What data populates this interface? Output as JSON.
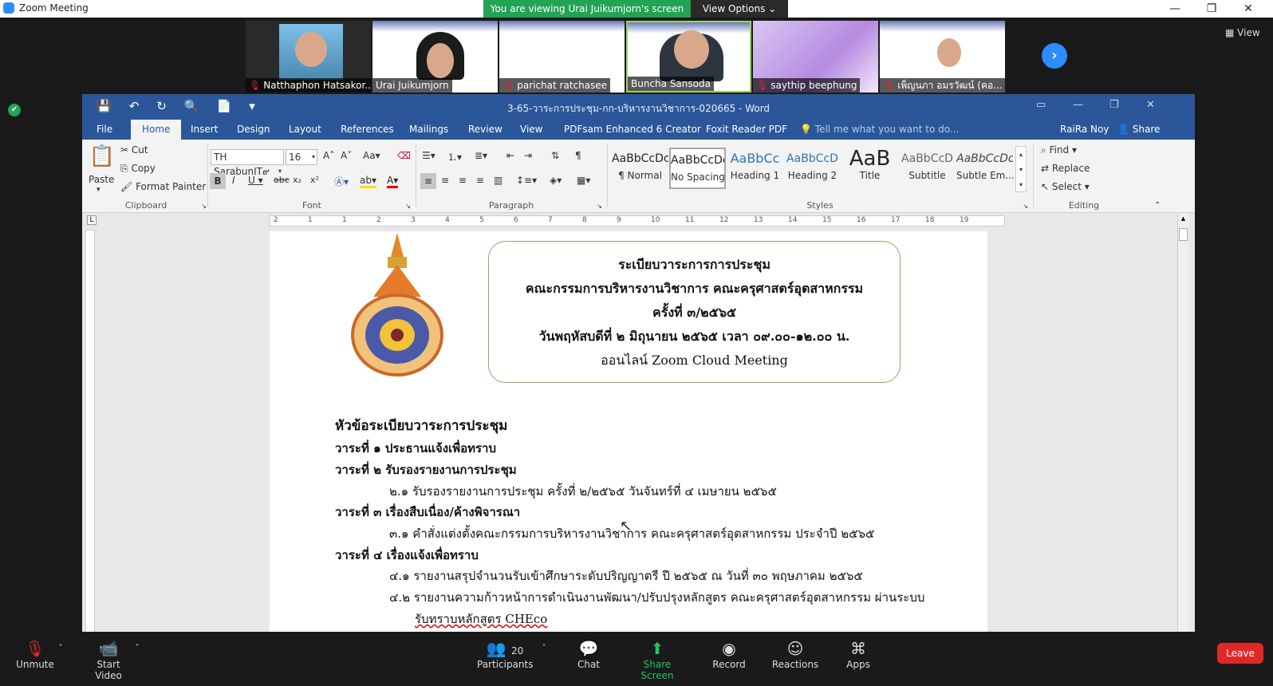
{
  "zoom": {
    "window_title": "Zoom Meeting",
    "share_banner": "You are viewing Urai Juikumjorn's screen",
    "view_options": "View Options",
    "view_button": "View",
    "participants": [
      {
        "name": "Natthaphon Hatsakor..."
      },
      {
        "name": "Urai Juikumjorn"
      },
      {
        "name": "parichat ratchasee"
      },
      {
        "name": "Buncha Sansoda"
      },
      {
        "name": "saythip beephung"
      },
      {
        "name": "เพ็ญนภา อมรวัฒน์ (คอ..."
      }
    ],
    "toolbar": {
      "unmute": "Unmute",
      "start_video": "Start Video",
      "participants": "Participants",
      "participant_count": "20",
      "chat": "Chat",
      "share_screen": "Share Screen",
      "record": "Record",
      "reactions": "Reactions",
      "apps": "Apps",
      "leave": "Leave"
    }
  },
  "word": {
    "doc_title": "3-65-วาระการประชุม-กก-บริหารงานวิชาการ-020665 - Word",
    "tabs": [
      "File",
      "Home",
      "Insert",
      "Design",
      "Layout",
      "References",
      "Mailings",
      "Review",
      "View",
      "PDFsam Enhanced 6 Creator",
      "Foxit Reader PDF"
    ],
    "tell_me": "Tell me what you want to do...",
    "user": "RaiRa Noy",
    "share": "Share",
    "clipboard": {
      "paste": "Paste",
      "cut": "Cut",
      "copy": "Copy",
      "format_painter": "Format Painter",
      "label": "Clipboard"
    },
    "font": {
      "name": "TH SarabunIT๙",
      "size": "16",
      "label": "Font"
    },
    "paragraph": {
      "label": "Paragraph"
    },
    "styles": {
      "label": "Styles",
      "items": [
        {
          "preview": "AaBbCcDc",
          "label": "¶ Normal"
        },
        {
          "preview": "AaBbCcDc",
          "label": "No Spacing"
        },
        {
          "preview": "AaBbCc",
          "label": "Heading 1"
        },
        {
          "preview": "AaBbCcD",
          "label": "Heading 2"
        },
        {
          "preview": "AaB",
          "label": "Title"
        },
        {
          "preview": "AaBbCcD",
          "label": "Subtitle"
        },
        {
          "preview": "AaBbCcDc",
          "label": "Subtle Em..."
        }
      ]
    },
    "editing": {
      "find": "Find",
      "replace": "Replace",
      "select": "Select",
      "label": "Editing"
    },
    "ruler_numbers": [
      "2",
      "1",
      "1",
      "2",
      "3",
      "4",
      "5",
      "6",
      "7",
      "8",
      "9",
      "10",
      "11",
      "12",
      "13",
      "14",
      "15",
      "16",
      "17",
      "18",
      "19"
    ],
    "document": {
      "header_lines": [
        "ระเบียบวาระการการประชุม",
        "คณะกรรมการบริหารงานวิชาการ คณะครุศาสตร์อุตสาหกรรม",
        "ครั้งที่ ๓/๒๕๖๕",
        "วันพฤหัสบดีที่ ๒ มิถุนายน ๒๕๖๕ เวลา ๐๙.๐๐-๑๒.๐๐ น.",
        "ออนไลน์ Zoom Cloud Meeting"
      ],
      "agenda_title": "หัวข้อระเบียบวาระการประชุม",
      "agenda": [
        {
          "text": "วาระที่ ๑ ประธานแจ้งเพื่อทราบ",
          "bold": true
        },
        {
          "text": "วาระที่ ๒ รับรองรายงานการประชุม",
          "bold": true
        },
        {
          "text": "๒.๑ รับรองรายงานการประชุม ครั้งที่ ๒/๒๕๖๕ วันจันทร์ที่ ๔ เมษายน ๒๕๖๕",
          "bold": false
        },
        {
          "text": "วาระที่ ๓ เรื่องสืบเนื่อง/ค้างพิจารณา",
          "bold": true
        },
        {
          "text": "๓.๑ คำสั่งแต่งตั้งคณะกรรมการบริหารงานวิชาการ คณะครุศาสตร์อุตสาหกรรม ประจำปี ๒๕๖๕",
          "bold": false
        },
        {
          "text": "วาระที่ ๔ เรื่องแจ้งเพื่อทราบ",
          "bold": true
        },
        {
          "text": "๔.๑ รายงานสรุปจำนวนรับเข้าศึกษาระดับปริญญาตรี ปี ๒๕๖๕ ณ วันที่ ๓๐ พฤษภาคม ๒๕๖๕",
          "bold": false
        },
        {
          "text": "๔.๒ รายงานความก้าวหน้าการดำเนินงานพัฒนา/ปรับปรุงหลักสูตร คณะครุศาสตร์อุตสาหกรรม ผ่านระบบ",
          "bold": false
        },
        {
          "text": "รับทราบหลักสูตร CHEco",
          "bold": false
        }
      ]
    }
  }
}
